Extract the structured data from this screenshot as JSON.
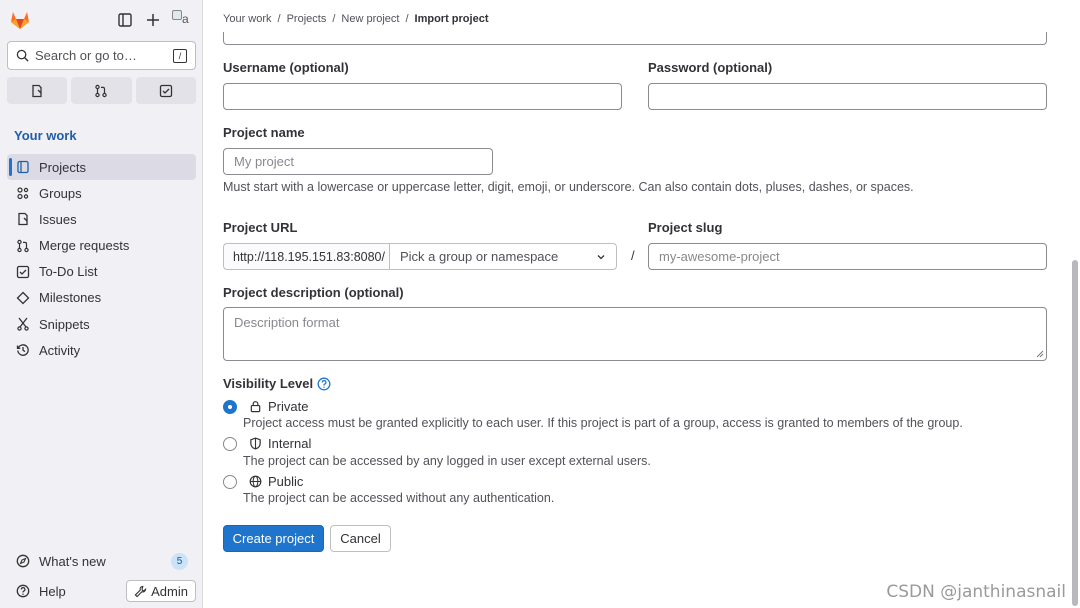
{
  "sidebar": {
    "search_placeholder": "Search or go to…",
    "search_shortcut": "/",
    "section_title": "Your work",
    "items": [
      {
        "label": "Projects",
        "icon": "project-icon",
        "active": true
      },
      {
        "label": "Groups",
        "icon": "group-icon"
      },
      {
        "label": "Issues",
        "icon": "issues-icon"
      },
      {
        "label": "Merge requests",
        "icon": "merge-request-icon"
      },
      {
        "label": "To-Do List",
        "icon": "todo-icon"
      },
      {
        "label": "Milestones",
        "icon": "milestone-icon"
      },
      {
        "label": "Snippets",
        "icon": "snippet-icon"
      },
      {
        "label": "Activity",
        "icon": "activity-icon"
      }
    ],
    "whats_new": "What's new",
    "whats_new_count": "5",
    "help": "Help",
    "admin": "Admin",
    "avatar_alt": "a"
  },
  "breadcrumb": [
    "Your work",
    "Projects",
    "New project",
    "Import project"
  ],
  "form": {
    "username_label": "Username (optional)",
    "password_label": "Password (optional)",
    "project_name_label": "Project name",
    "project_name_placeholder": "My project",
    "project_name_help": "Must start with a lowercase or uppercase letter, digit, emoji, or underscore. Can also contain dots, pluses, dashes, or spaces.",
    "project_url_label": "Project URL",
    "project_url_prefix": "http://118.195.151.83:8080/",
    "namespace_placeholder": "Pick a group or namespace",
    "slash": "/",
    "project_slug_label": "Project slug",
    "project_slug_placeholder": "my-awesome-project",
    "description_label": "Project description (optional)",
    "description_placeholder": "Description format",
    "visibility_label": "Visibility Level",
    "visibility": [
      {
        "label": "Private",
        "desc": "Project access must be granted explicitly to each user. If this project is part of a group, access is granted to members of the group.",
        "checked": true
      },
      {
        "label": "Internal",
        "desc": "The project can be accessed by any logged in user except external users."
      },
      {
        "label": "Public",
        "desc": "The project can be accessed without any authentication."
      }
    ],
    "create_button": "Create project",
    "cancel_button": "Cancel"
  },
  "watermark": "CSDN @janthinasnail",
  "colors": {
    "primary": "#1f75cb",
    "sidebar_bg": "#f1f0f4",
    "section_title": "#1f5fa7"
  }
}
